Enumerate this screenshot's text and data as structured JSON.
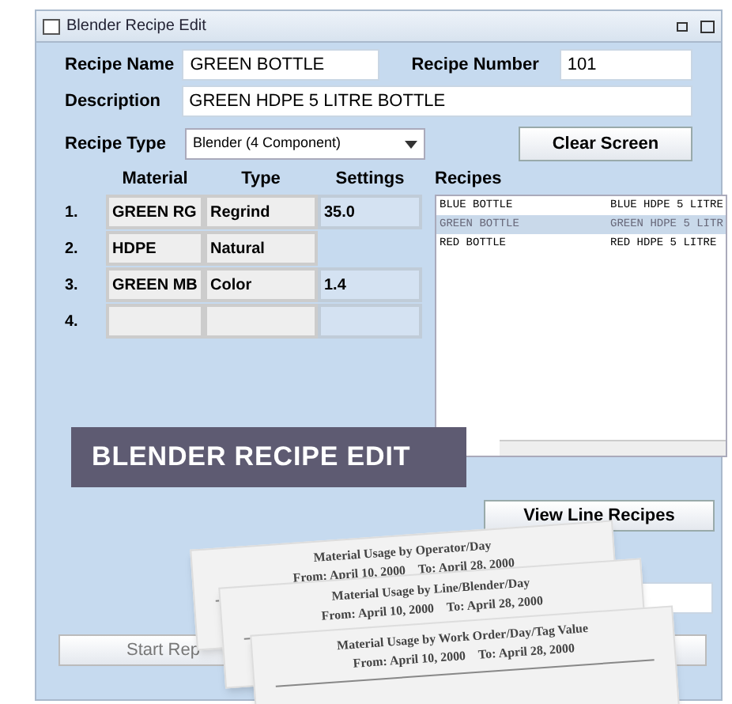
{
  "window": {
    "title": "Blender Recipe Edit"
  },
  "form": {
    "recipe_name_label": "Recipe Name",
    "recipe_name": "GREEN BOTTLE",
    "recipe_number_label": "Recipe Number",
    "recipe_number": "101",
    "description_label": "Description",
    "description": "GREEN HDPE 5 LITRE BOTTLE",
    "recipe_type_label": "Recipe Type",
    "recipe_type": "Blender (4 Component)"
  },
  "clear_button": "Clear Screen",
  "components": {
    "columns": [
      "Material",
      "Type",
      "Settings"
    ],
    "rows": [
      {
        "number": "1.",
        "material": "GREEN RG",
        "type": "Regrind",
        "settings": "35.0"
      },
      {
        "number": "2.",
        "material": "HDPE",
        "type": "Natural"
      },
      {
        "number": "3.",
        "material": "GREEN MB",
        "type": "Color",
        "settings": "1.4"
      },
      {
        "number": "4.",
        "material": "",
        "type": "",
        "settings": ""
      }
    ]
  },
  "recipes": {
    "title": "Recipes",
    "items": [
      {
        "name": "BLUE BOTTLE",
        "description": "BLUE HDPE 5 LITRE",
        "selected": false
      },
      {
        "name": "GREEN BOTTLE",
        "description": "GREEN HDPE 5 LITR",
        "selected": true
      },
      {
        "name": "RED BOTTLE",
        "description": "RED HDPE 5 LITRE",
        "selected": false
      }
    ]
  },
  "banner": "BLENDER RECIPE EDIT",
  "view_button": "View Line Recipes",
  "start_button": "Start Rep",
  "reports": [
    {
      "title": "Material Usage by Operator/Day",
      "from": "From: April 10, 2000",
      "to": "To: April 28, 2000"
    },
    {
      "title": "Material Usage by Line/Blender/Day",
      "from": "From: April 10, 2000",
      "to": "To: April 28, 2000"
    },
    {
      "title": "Material Usage by Work Order/Day/Tag Value",
      "from": "From: April 10, 2000",
      "to": "To: April 28, 2000"
    }
  ]
}
